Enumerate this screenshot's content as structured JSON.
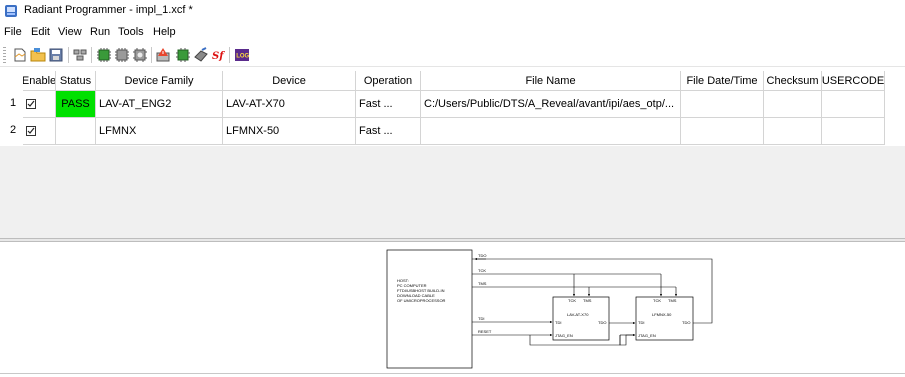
{
  "window": {
    "title": "Radiant Programmer - impl_1.xcf *"
  },
  "menu": [
    "File",
    "Edit",
    "View",
    "Run",
    "Tools",
    "Help"
  ],
  "toolbar": {
    "log_label": "LOG",
    "sf_label": "Sf"
  },
  "grid": {
    "headers": [
      "Enable",
      "Status",
      "Device Family",
      "Device",
      "Operation",
      "File Name",
      "File Date/Time",
      "Checksum",
      "USERCODE"
    ],
    "rows": [
      {
        "num": "1",
        "enabled": true,
        "status": "PASS",
        "family": "LAV-AT_ENG2",
        "device": "LAV-AT-X70",
        "operation": "Fast ...",
        "file_name": "C:/Users/Public/DTS/A_Reveal/avant/ipi/aes_otp/...",
        "file_date": "",
        "checksum": "",
        "usercode": ""
      },
      {
        "num": "2",
        "enabled": true,
        "status": "",
        "family": "LFMNX",
        "device": "LFMNX-50",
        "operation": "Fast ...",
        "file_name": "",
        "file_date": "",
        "checksum": "",
        "usercode": ""
      }
    ]
  },
  "colors": {
    "pass": "#00e000"
  },
  "diagram": {
    "host_lines": [
      "HOST:",
      "PC COMPUTER",
      "FTDI/USBHOST BUILD-IN",
      "DOWNLOAD CABLE",
      "OF UMICROPROCESSOR"
    ],
    "signals": {
      "tdo": "TDO",
      "tck": "TCK",
      "tms": "TMS",
      "tdi": "TDI",
      "reset": "RESET"
    },
    "chip1": {
      "name": "LAV-AT-X70",
      "tck": "TCK",
      "tms": "TMS",
      "tdi": "TDI",
      "tdo": "TDO",
      "en": "JTAG_EN"
    },
    "chip2": {
      "name": "LFMNX-50",
      "tck": "TCK",
      "tms": "TMS",
      "tdi": "TDI",
      "tdo": "TDO",
      "en": "JTAG_EN"
    }
  }
}
